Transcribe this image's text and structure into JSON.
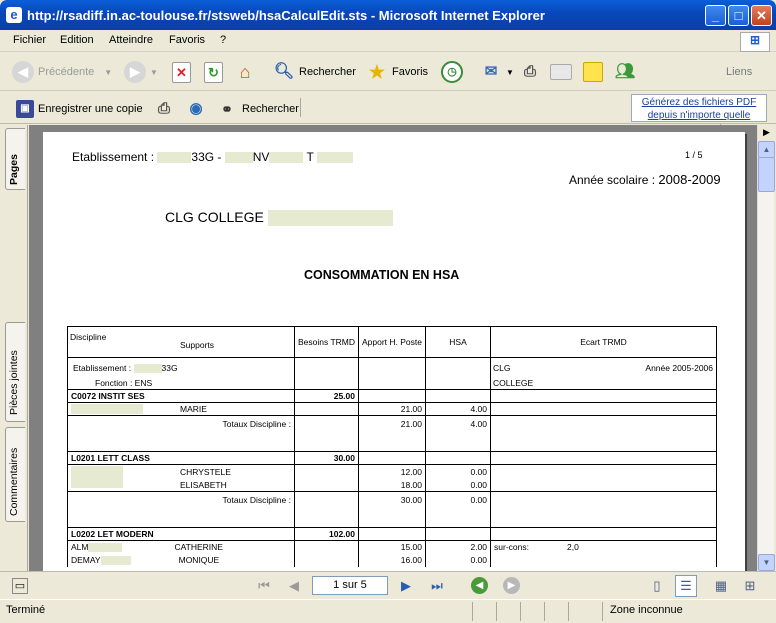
{
  "window": {
    "title": "http://rsadiff.in.ac-toulouse.fr/stsweb/hsaCalculEdit.sts - Microsoft Internet Explorer",
    "icon": "ie-icon",
    "controls": {
      "minimize": "_",
      "maximize": "□",
      "close": "✕"
    }
  },
  "menu": [
    "Fichier",
    "Edition",
    "Atteindre",
    "Favoris",
    "?"
  ],
  "toolbar": {
    "back": "Précédente",
    "search": "Rechercher",
    "favorites": "Favoris",
    "links": "Liens"
  },
  "pdf_toolbar": {
    "save_copy": "Enregistrer une copie",
    "search": "Rechercher",
    "ad": "Générez des fichiers PDF depuis n'importe quelle"
  },
  "side_tabs": [
    "Pages",
    "Pièces jointes",
    "Commentaires"
  ],
  "document": {
    "etab_label": "Etablissement :",
    "etab_code": "33G -",
    "etab_mid": "NV",
    "etab_t": "T",
    "page_num": "1 / 5",
    "annee": "Année scolaire :",
    "annee_value": "2008-2009",
    "college": "CLG COLLEGE",
    "heading": "CONSOMMATION EN HSA",
    "headers": {
      "discipline": "Discipline",
      "supports": "Supports",
      "besoins": "Besoins TRMD",
      "apport": "Apport H. Poste",
      "hsa": "HSA",
      "ecart": "Ecart TRMD"
    },
    "info": {
      "etab": "Etablissement :",
      "code": "33G",
      "fonction": "Fonction :  ENS",
      "clg": "CLG",
      "college": "COLLEGE",
      "annee": "Année 2005-2006"
    },
    "sections": [
      {
        "code": "C0072 INSTIT SES",
        "besoins": "25.00",
        "rows": [
          {
            "name": "MARIE",
            "apport": "21.00",
            "hsa": "4.00"
          }
        ],
        "total_label": "Totaux Discipline :",
        "total_apport": "21.00",
        "total_hsa": "4.00"
      },
      {
        "code": "L0201 LETT CLASS",
        "besoins": "30.00",
        "rows": [
          {
            "name": "CHRYSTELE",
            "apport": "12.00",
            "hsa": "0.00"
          },
          {
            "name": "ELISABETH",
            "apport": "18.00",
            "hsa": "0.00"
          }
        ],
        "total_label": "Totaux Discipline :",
        "total_apport": "30.00",
        "total_hsa": "0.00"
      },
      {
        "code": "L0202 LET MODERN",
        "besoins": "102.00",
        "rows": [
          {
            "pre": "ALM",
            "name": "CATHERINE",
            "apport": "15.00",
            "hsa": "2.00",
            "ecart": "sur-cons:",
            "ecart_val": "2,0"
          },
          {
            "pre": "DEMAY",
            "name": "MONIQUE",
            "apport": "16.00",
            "hsa": "0.00"
          }
        ]
      }
    ]
  },
  "pager": {
    "value": "1 sur 5"
  },
  "status": {
    "left": "Terminé",
    "zone": "Zone inconnue"
  }
}
